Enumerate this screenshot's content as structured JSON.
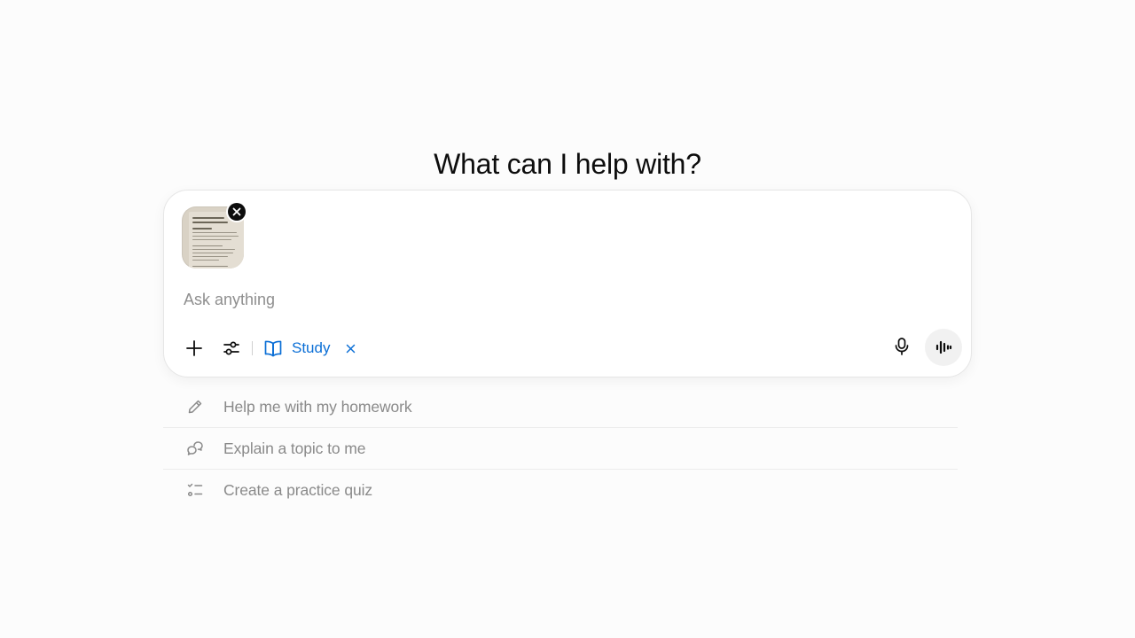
{
  "main": {
    "headline": "What can I help with?"
  },
  "composer": {
    "attachment_icon": "document-thumbnail",
    "remove_attachment_icon": "close-icon",
    "input": {
      "value": "",
      "placeholder": "Ask anything"
    },
    "toolbar": {
      "add_icon": "plus-icon",
      "tools_icon": "sliders-icon",
      "mode_chip": {
        "label": "Study",
        "icon": "open-book-icon",
        "remove_icon": "close-icon",
        "color": "#0b6fd6"
      },
      "dictate_icon": "microphone-icon",
      "voice_icon": "voice-waveform-icon"
    }
  },
  "suggestions": [
    {
      "label": "Help me with my homework",
      "icon": "pencil-icon"
    },
    {
      "label": "Explain a topic to me",
      "icon": "chat-bubbles-icon"
    },
    {
      "label": "Create a practice quiz",
      "icon": "checklist-icon"
    }
  ]
}
